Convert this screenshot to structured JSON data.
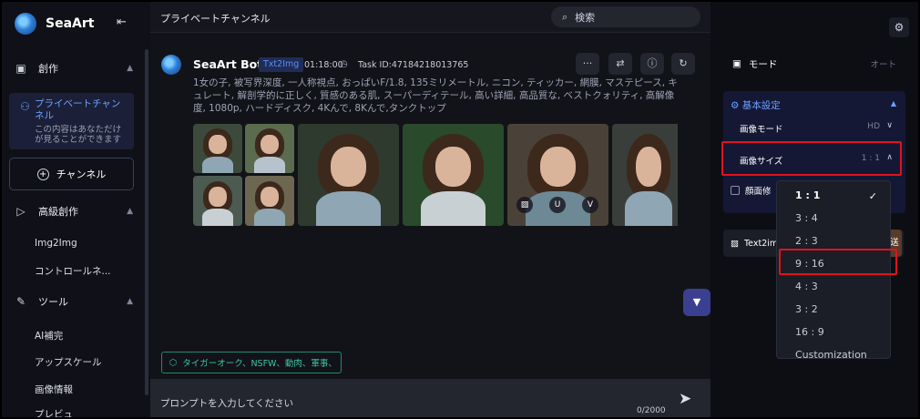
{
  "sidebar": {
    "brand": "SeaArt",
    "create": "創作",
    "private_channel": "プライベートチャンネル",
    "private_note": "この内容はあなただけが見ることができます",
    "channel_button": "チャンネル",
    "advanced": "高級創作",
    "img2img": "Img2Img",
    "controlnet": "コントロールネ...",
    "tools": "ツール",
    "ai_fill": "AI補完",
    "upscale": "アップスケール",
    "image_info": "画像情報",
    "preview": "プレビュ"
  },
  "main": {
    "channel_title": "プライベートチャンネル",
    "search_label": "検索",
    "bot_name": "SeaArt Bot",
    "tag": "Txt2Img",
    "time": "01:18:00",
    "task_id": "Task ID:47184218013765",
    "prompt": "1女の子, 被写界深度, 一人称視点, おっぱいF/1.8, 135ミリメートル, ニコン, ティッカー, 網膜, マステピース, キュレート, 解剖学的に正しく, 質感のある肌, スーパーディテール, 高い詳細, 高品質な, ベストクォリティ, 高解像度, 1080p, ハードディスク, 4Kんで, 8Kんで,タンクトップ",
    "overlay_u": "U",
    "overlay_v": "V",
    "filter_tag": "タイガーオーク、NSFW、動肉、軍事、",
    "input_placeholder": "プロンプトを入力してください",
    "counter": "0/2000"
  },
  "right": {
    "mode_label": "モード",
    "mode_value": "オート",
    "basic_settings": "基本設定",
    "image_mode_label": "画像モード",
    "image_mode_value": "HD",
    "image_size_label": "画像サイズ",
    "image_size_value": "1 : 1",
    "face_label": "顔面修",
    "t2i_label": "Text2im",
    "t2i_side": "送"
  },
  "dropdown": {
    "options": [
      "1 : 1",
      "3 : 4",
      "2 : 3",
      "9 : 16",
      "4 : 3",
      "3 : 2",
      "16 : 9",
      "Customization"
    ],
    "selected": "1 : 1"
  },
  "colors": {
    "accent": "#6ea0ff",
    "highlight": "#e0131b",
    "teal": "#3cc7a0"
  }
}
